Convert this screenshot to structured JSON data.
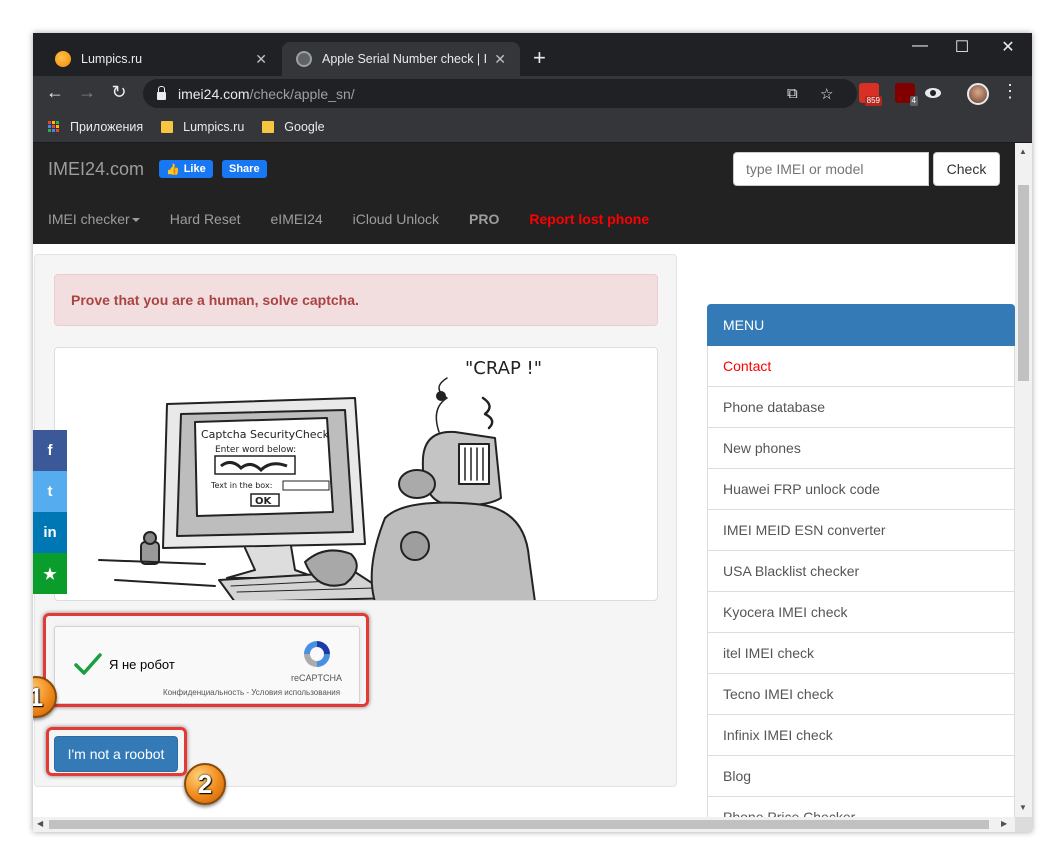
{
  "browser": {
    "tabs": [
      {
        "title": "Lumpics.ru",
        "active": false
      },
      {
        "title": "Apple Serial Number check | IMEI",
        "active": true
      }
    ],
    "new_tab": "+",
    "window_controls": {
      "minimize": "—",
      "maximize": "☐",
      "close": "✕"
    },
    "nav": {
      "back": "←",
      "forward": "→",
      "reload": "↻"
    },
    "url": {
      "host": "imei24.com",
      "path": "/check/apple_sn/"
    },
    "extensions": [
      {
        "name": "mail-extension",
        "badge": "859",
        "color": "#d93025"
      },
      {
        "name": "ublock-extension",
        "badge": "4",
        "color": "#800000"
      }
    ],
    "bookmarks": [
      "Приложения",
      "Lumpics.ru",
      "Google"
    ]
  },
  "site": {
    "brand": "IMEI24.com",
    "fb_like": "Like",
    "fb_share": "Share",
    "search_placeholder": "type IMEI or model",
    "check_label": "Check",
    "nav": [
      "IMEI checker",
      "Hard Reset",
      "eIMEI24",
      "iCloud Unlock",
      "PRO",
      "Report lost phone"
    ]
  },
  "main": {
    "alert": "Prove that you are a human, solve captcha.",
    "cartoon": {
      "speech": "\"CRAP !\"",
      "screen_title": "Captcha SecurityCheck",
      "screen_prompt": "Enter word below:",
      "screen_text_label": "Text in the box:",
      "screen_ok": "OK"
    },
    "recaptcha": {
      "label": "Я не робот",
      "brand": "reCAPTCHA",
      "links": "Конфиденциальность - Условия использования"
    },
    "submit": "I'm not a roobot",
    "badges": [
      "1",
      "2"
    ]
  },
  "social": [
    {
      "icon": "f",
      "color": "#3b5998"
    },
    {
      "icon": "t",
      "color": "#55acee"
    },
    {
      "icon": "in",
      "color": "#0077b5"
    },
    {
      "icon": "★",
      "color": "#0a9d2c"
    }
  ],
  "menu": {
    "title": "MENU",
    "items": [
      "Contact",
      "Phone database",
      "New phones",
      "Huawei FRP unlock code",
      "IMEI MEID ESN converter",
      "USA Blacklist checker",
      "Kyocera IMEI check",
      "itel IMEI check",
      "Tecno IMEI check",
      "Infinix IMEI check",
      "Blog",
      "Phone Price Checker"
    ]
  }
}
